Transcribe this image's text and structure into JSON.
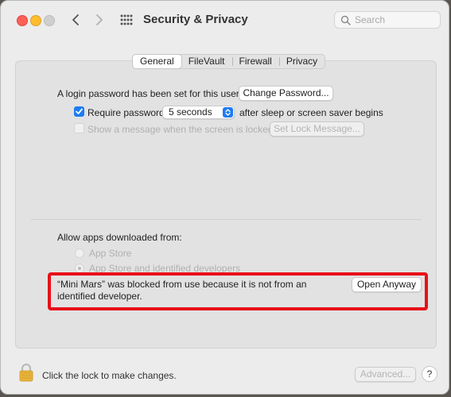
{
  "window": {
    "title": "Security & Privacy"
  },
  "search": {
    "placeholder": "Search"
  },
  "tabs": [
    {
      "label": "General",
      "selected": true
    },
    {
      "label": "FileVault",
      "selected": false
    },
    {
      "label": "Firewall",
      "selected": false
    },
    {
      "label": "Privacy",
      "selected": false
    }
  ],
  "general": {
    "login_password_text": "A login password has been set for this user",
    "change_password_label": "Change Password...",
    "require_password_label": "Require password",
    "require_password_checked": true,
    "require_password_delay": "5 seconds",
    "after_sleep_text": "after sleep or screen saver begins",
    "show_message_label": "Show a message when the screen is locked",
    "show_message_checked": false,
    "set_lock_message_label": "Set Lock Message...",
    "allow_apps_title": "Allow apps downloaded from:",
    "allow_options": [
      {
        "label": "App Store",
        "selected": false
      },
      {
        "label": "App Store and identified developers",
        "selected": true
      }
    ],
    "blocked_message_line1": "“Mini Mars” was blocked from use because it is not from an",
    "blocked_message_line2": "identified developer.",
    "open_anyway_label": "Open Anyway"
  },
  "footer": {
    "lock_text": "Click the lock to make changes.",
    "advanced_label": "Advanced...",
    "help_label": "?"
  },
  "icons": {
    "back": "chevron-left-icon",
    "forward": "chevron-right-icon",
    "grid": "grid-icon",
    "search": "magnifier-icon",
    "lock": "lock-icon"
  },
  "colors": {
    "accent": "#1d7cf2",
    "highlight": "#e8101a"
  }
}
